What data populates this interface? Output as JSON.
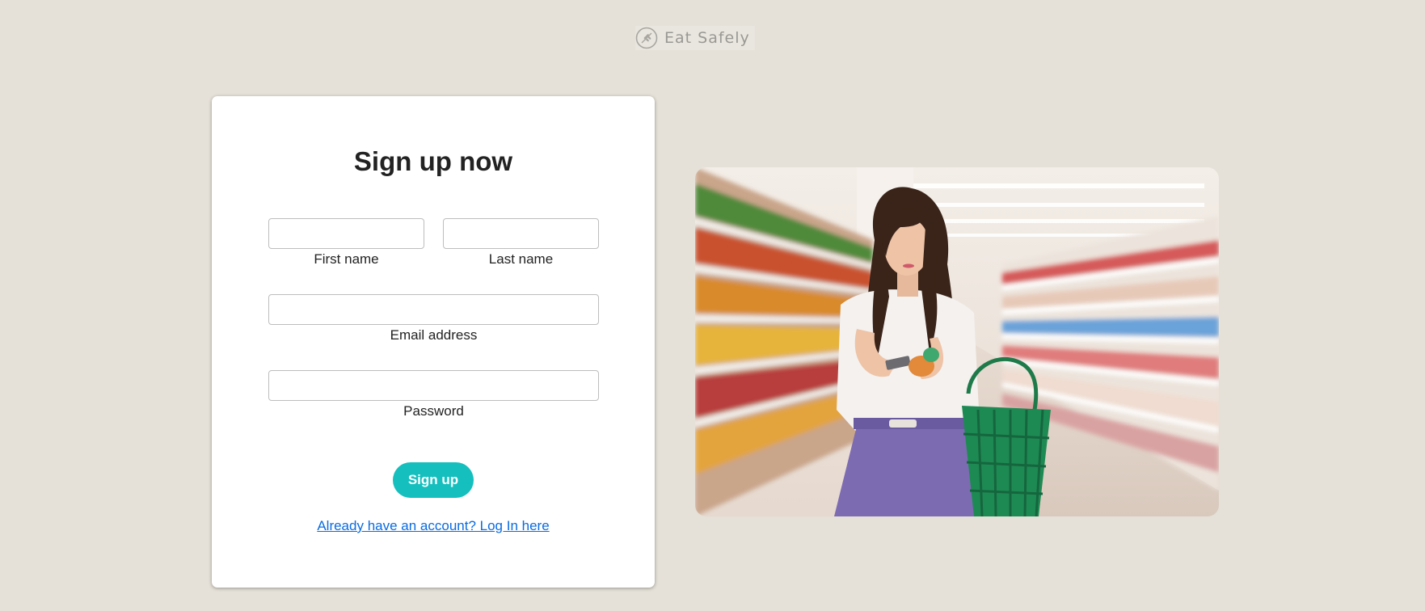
{
  "brand": {
    "name": "Eat Safely",
    "logo_icon": "wheat-leaf-icon"
  },
  "signup_form": {
    "title": "Sign up now",
    "fields": {
      "first_name": {
        "label": "First name",
        "value": "",
        "placeholder": ""
      },
      "last_name": {
        "label": "Last name",
        "value": "",
        "placeholder": ""
      },
      "email": {
        "label": "Email address",
        "value": "",
        "placeholder": ""
      },
      "password": {
        "label": "Password",
        "value": "",
        "placeholder": ""
      }
    },
    "submit_label": "Sign up",
    "login_link": "Already have an account? Log In here"
  },
  "hero_image": {
    "alt": "woman-shopping-in-grocery-store-photo"
  },
  "colors": {
    "background": "#e5e1d8",
    "accent": "#14bfbe",
    "link": "#0b6be0",
    "card": "#ffffff"
  }
}
